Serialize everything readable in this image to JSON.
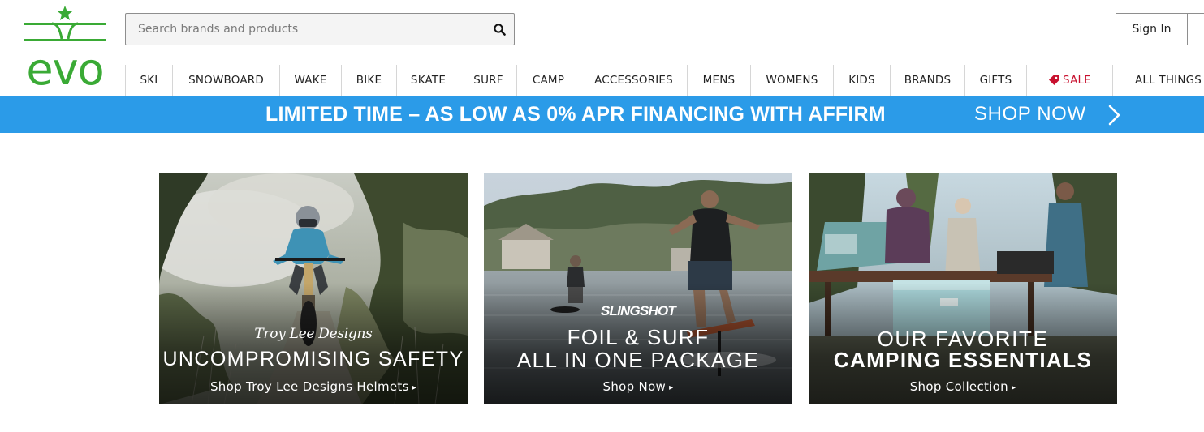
{
  "brand": {
    "name": "evo",
    "color": "#3aaa35"
  },
  "search": {
    "placeholder": "Search brands and products",
    "value": "",
    "icon": "search-icon"
  },
  "account": {
    "signin_label": "Sign In"
  },
  "nav": {
    "items": [
      {
        "label": "SKI"
      },
      {
        "label": "SNOWBOARD"
      },
      {
        "label": "WAKE"
      },
      {
        "label": "BIKE"
      },
      {
        "label": "SKATE"
      },
      {
        "label": "SURF"
      },
      {
        "label": "CAMP"
      },
      {
        "label": "ACCESSORIES"
      },
      {
        "label": "MENS"
      },
      {
        "label": "WOMENS"
      },
      {
        "label": "KIDS"
      },
      {
        "label": "BRANDS"
      },
      {
        "label": "GIFTS"
      },
      {
        "label": "SALE",
        "icon": "tag-icon",
        "color": "#c8102e"
      },
      {
        "label": "ALL THINGS"
      }
    ]
  },
  "promo": {
    "text": "LIMITED TIME – AS LOW AS 0% APR FINANCING WITH AFFIRM",
    "cta": "SHOP NOW",
    "icon": "chevron-right-icon",
    "background": "#2b9be8"
  },
  "tiles": [
    {
      "brand_logo_text": "Troy Lee Designs",
      "line1": "UNCOMPROMISING SAFETY",
      "line2": "",
      "cta": "Shop Troy Lee Designs Helmets",
      "arrow": "▸"
    },
    {
      "brand_logo_text": "SLINGSHOT",
      "line1": "FOIL & SURF",
      "line2": "ALL IN ONE PACKAGE",
      "cta": "Shop Now",
      "arrow": "▸"
    },
    {
      "brand_logo_text": "",
      "line1": "OUR FAVORITE",
      "line2": "CAMPING ESSENTIALS",
      "cta": "Shop Collection",
      "arrow": "▸"
    }
  ]
}
